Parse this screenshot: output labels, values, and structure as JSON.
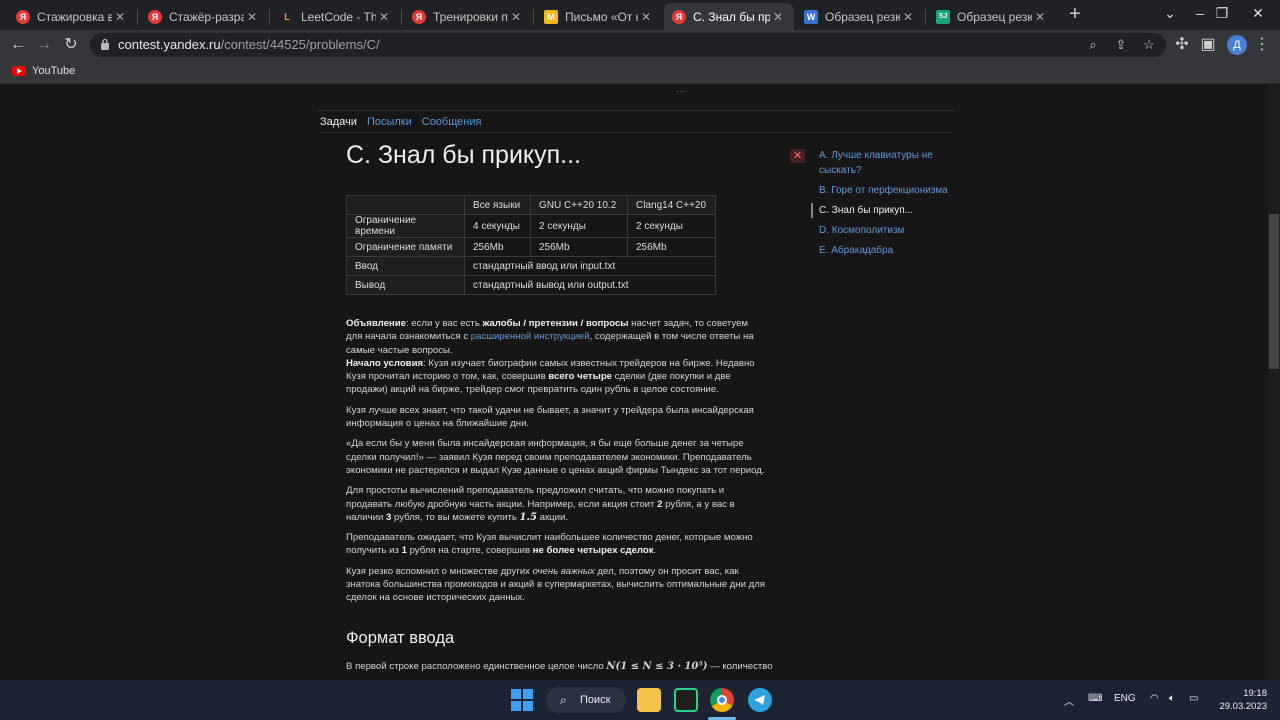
{
  "browser": {
    "tabs": [
      {
        "title": "Стажировка в Ян",
        "favicon_color": "#e53935",
        "favicon_glyph": "Я"
      },
      {
        "title": "Стажёр-разработ",
        "favicon_color": "#e53935",
        "favicon_glyph": "Я"
      },
      {
        "title": "LeetCode - The W",
        "favicon_color": "#f5a623",
        "favicon_glyph": "L"
      },
      {
        "title": "Тренировки по а",
        "favicon_color": "#e53935",
        "favicon_glyph": "Я"
      },
      {
        "title": "Письмо «От ком",
        "favicon_color": "#f2b61f",
        "favicon_glyph": "M"
      },
      {
        "title": "C. Знал бы прику",
        "favicon_color": "#e53935",
        "favicon_glyph": "Я"
      },
      {
        "title": "Образец резюме",
        "favicon_color": "#3b6fd1",
        "favicon_glyph": "W"
      },
      {
        "title": "Образец резюме",
        "favicon_color": "#1aa37a",
        "favicon_glyph": "SJ"
      }
    ],
    "active_tab_index": 5,
    "url_host": "contest.yandex.ru",
    "url_path": "/contest/44525/problems/C/",
    "profile_initial": "Д",
    "bookmarks": [
      {
        "label": "YouTube",
        "icon": "youtube-icon"
      }
    ]
  },
  "contest": {
    "nav": [
      "Задачи",
      "Посылки",
      "Сообщения"
    ],
    "problem_title": "C. Знал бы прикуп...",
    "limits_table": {
      "header": [
        "",
        "Все языки",
        "GNU C++20 10.2",
        "Clang14 C++20"
      ],
      "time_row": [
        "Ограничение времени",
        "4 секунды",
        "2 секунды",
        "2 секунды"
      ],
      "memory_row": [
        "Ограничение памяти",
        "256Mb",
        "256Mb",
        "256Mb"
      ],
      "input_row": [
        "Ввод",
        "стандартный ввод или input.txt"
      ],
      "output_row": [
        "Вывод",
        "стандартный вывод или output.txt"
      ]
    },
    "statement": {
      "p1_b1": "Объявление",
      "p1_t1": ": если у вас есть ",
      "p1_b2": "жалобы / претензии / вопросы",
      "p1_t2": " насчет задач, то советуем для начала ознакомиться с ",
      "p1_link": "расширенной инструкцией",
      "p1_t3": ", содержащей в том числе ответы на самые частые вопросы.",
      "p1_b3": "Начало условия",
      "p1_t4": ": Кузя изучает биографии самых известных трейдеров на бирже. Недавно Кузя прочитал историю о том, как, совершив ",
      "p1_b4": "всего четыре",
      "p1_t5": " сделки (две покупки и две продажи) акций на бирже, трейдер смог превратить один рубль в целое состояние.",
      "p2": "Кузя лучше всех знает, что такой удачи не бывает, а значит у трейдера была инсайдерская информация о ценах на ближайшие дни.",
      "p3": "«Да если бы у меня была инсайдерская информация, я бы еще больше денег за четыре сделки получил!» — заявил Кузя перед своим преподавателем экономики. Преподаватель экономики не растерялся и выдал Кузе данные о ценах акций фирмы Тындекс за тот период.",
      "p4_t1": "Для простоты вычислений преподаватель предложил считать, что можно покупать и продавать любую дробную часть акции. Например, если акция стоит ",
      "p4_n1": "2",
      "p4_t2": " рубля, а у вас в наличии ",
      "p4_n2": "3",
      "p4_t3": " рубля, то вы можете купить ",
      "p4_n3": "1.5",
      "p4_t4": " акции.",
      "p5_t1": "Преподаватель ожидает, что Кузя вычислит наибольшее количество денег, которые можно получить из ",
      "p5_n1": "1",
      "p5_t2": " рубля на старте, совершив ",
      "p5_b1": "не более четырех сделок",
      "p5_t3": ".",
      "p6_t1": "Кузя резко вспомнил о множестве других ",
      "p6_i1": "очень важных",
      "p6_t2": " дел, поэтому он просит вас, как знатока большинства промокодов и акций в супермаркетах, вычислить оптимальные дни для сделок на основе исторических данных."
    },
    "input_format_heading": "Формат ввода",
    "input_format_line_start": "В первой строке расположено единственное целое число ",
    "input_format_math": "N(1 ≤ N ≤ 3 · 10⁵)",
    "input_format_line_end": " — количество",
    "problems": [
      {
        "label": "A. Лучше клавиатуры не сыскать?",
        "status": "wrong",
        "status_glyph": "✕"
      },
      {
        "label": "B. Горе от перфекционизма",
        "status": "none"
      },
      {
        "label": "C. Знал бы прикуп...",
        "status": "current"
      },
      {
        "label": "D. Космополитизм",
        "status": "none"
      },
      {
        "label": "E. Абракадабра",
        "status": "none"
      }
    ]
  },
  "taskbar": {
    "search_label": "Поиск",
    "lang": "ENG",
    "time": "19:18",
    "date": "29.03.2023"
  }
}
